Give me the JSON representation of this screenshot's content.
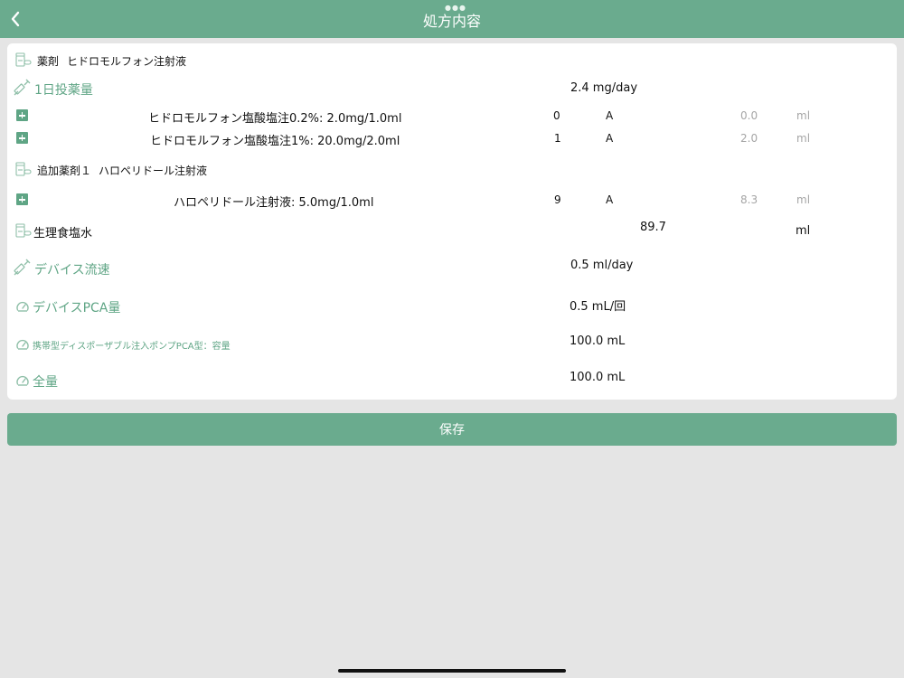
{
  "nav": {
    "title": "処方内容",
    "back_icon": "chevron-left-icon",
    "more_icon": "more-dots-icon"
  },
  "drug": {
    "icon": "medicine-bottle-icon",
    "label": "薬剤",
    "name": "ヒドロモルフォン注射液"
  },
  "daily_dose": {
    "icon": "syringe-icon",
    "label": "1日投薬量",
    "value": "2.4 mg/day"
  },
  "drug_items": [
    {
      "name": "ヒドロモルフォン塩酸塩注0.2%: 2.0mg/1.0ml",
      "count": "0",
      "unit": "A",
      "volume": "0.0",
      "volume_unit": "ml"
    },
    {
      "name": "ヒドロモルフォン塩酸塩注1%: 20.0mg/2.0ml",
      "count": "1",
      "unit": "A",
      "volume": "2.0",
      "volume_unit": "ml"
    }
  ],
  "additional_drug": {
    "icon": "medicine-bottle-icon",
    "label": "追加薬剤１",
    "name": "ハロペリドール注射液"
  },
  "additional_items": [
    {
      "name": "ハロペリドール注射液: 5.0mg/1.0ml",
      "count": "9",
      "unit": "A",
      "volume": "8.3",
      "volume_unit": "ml"
    }
  ],
  "saline": {
    "icon": "medicine-bottle-icon",
    "label": "生理食塩水",
    "value": "89.7",
    "unit": "ml"
  },
  "device_flow": {
    "icon": "syringe-icon",
    "label": "デバイス流速",
    "value": "0.5 ml/day"
  },
  "device_pca": {
    "icon": "gauge-icon",
    "label": "デバイスPCA量",
    "value": "0.5 mL/回"
  },
  "pump_capacity": {
    "icon": "gauge-icon",
    "label": "携帯型ディスポーザブル注入ポンプPCA型：容量",
    "value": "100.0 mL"
  },
  "total": {
    "icon": "gauge-icon",
    "label": "全量",
    "value": "100.0 mL"
  },
  "save_label": "保存",
  "colors": {
    "accent": "#6aab8e",
    "text_green": "#5fa585",
    "background": "#e5e5e5"
  }
}
